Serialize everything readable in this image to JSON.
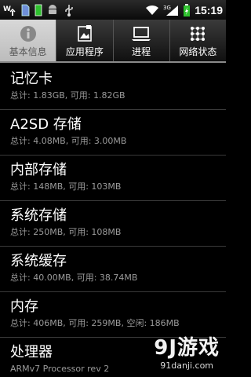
{
  "statusbar": {
    "time": "15:19",
    "left_icons": [
      "usb-debug-icon",
      "sd-card-icon",
      "battery-full-icon",
      "android-icon",
      "usb-icon"
    ],
    "right_icons": [
      "wifi-icon",
      "3g-signal-icon",
      "battery-charging-icon"
    ]
  },
  "tabs": [
    {
      "label": "基本信息",
      "icon": "info-icon",
      "active": true
    },
    {
      "label": "应用程序",
      "icon": "apps-icon",
      "active": false
    },
    {
      "label": "进程",
      "icon": "process-icon",
      "active": false
    },
    {
      "label": "网络状态",
      "icon": "network-icon",
      "active": false
    }
  ],
  "items": [
    {
      "title": "记忆卡",
      "sub": "总计: 1.83GB, 可用: 1.82GB"
    },
    {
      "title": "A2SD 存储",
      "sub": "总计: 4.08MB, 可用: 3.00MB"
    },
    {
      "title": "内部存储",
      "sub": "总计: 148MB, 可用: 103MB"
    },
    {
      "title": "系统存储",
      "sub": "总计: 250MB, 可用: 108MB"
    },
    {
      "title": "系统缓存",
      "sub": "总计: 40.00MB, 可用: 38.74MB"
    },
    {
      "title": "内存",
      "sub": "总计: 406MB, 可用: 259MB, 空闲: 186MB"
    },
    {
      "title": "处理器",
      "sub": "ARMv7 Processor rev 2"
    }
  ],
  "watermark": {
    "brand": "9J游戏",
    "site": "91danji.com"
  }
}
